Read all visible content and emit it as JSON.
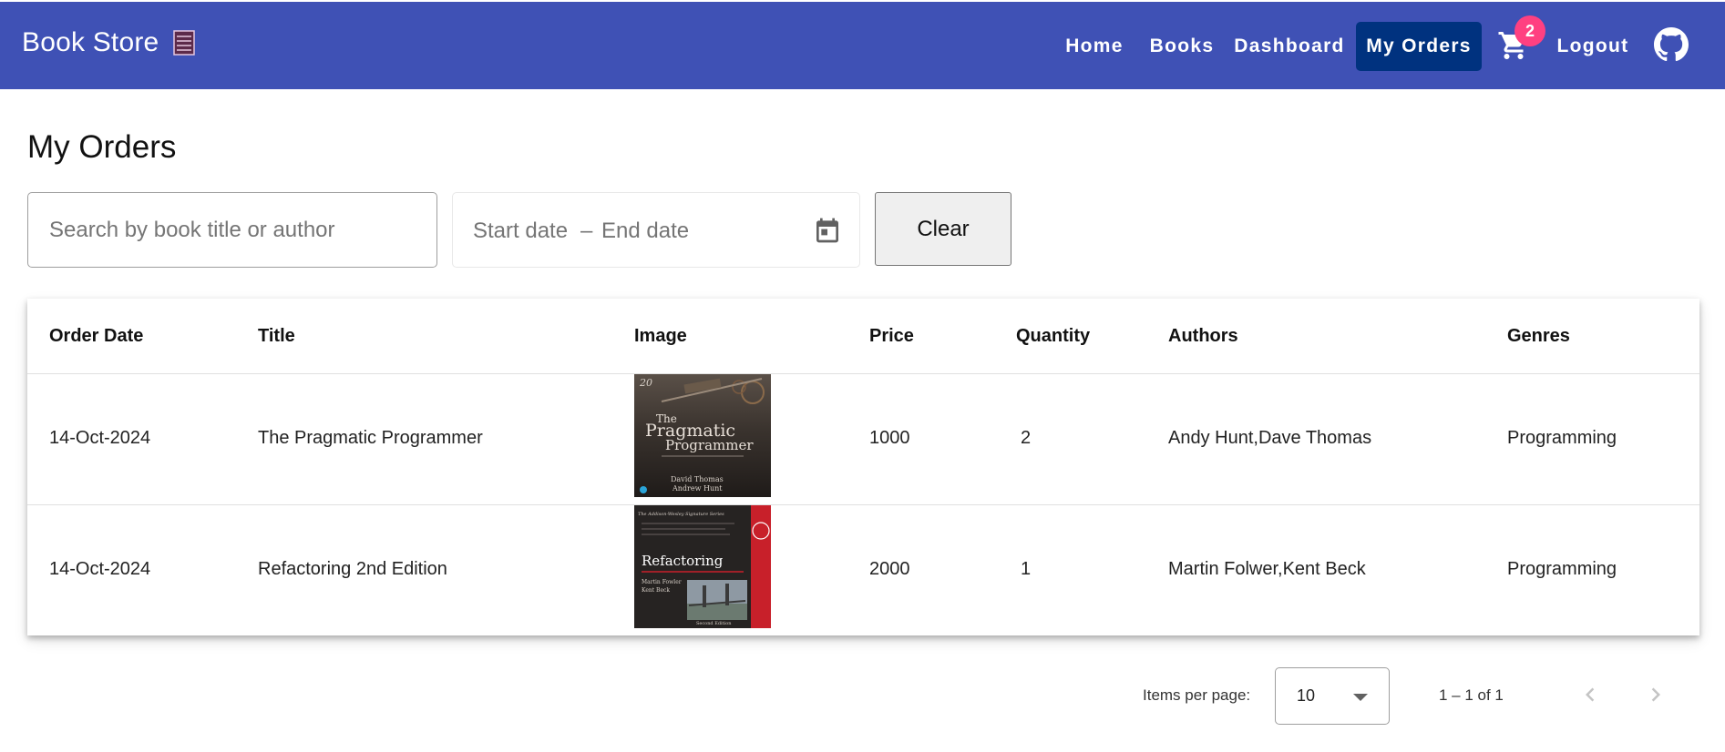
{
  "app": {
    "title": "Book Store",
    "brand_icon": "books-icon"
  },
  "nav": {
    "items": [
      {
        "label": "Home",
        "active": false
      },
      {
        "label": "Books",
        "active": false
      },
      {
        "label": "Dashboard",
        "active": false
      },
      {
        "label": "My Orders",
        "active": true
      }
    ],
    "cart_icon": "cart-icon",
    "cart_count": "2",
    "logout_label": "Logout",
    "github_icon": "github-icon"
  },
  "page": {
    "title": "My Orders"
  },
  "filters": {
    "search_placeholder": "Search by book title or author",
    "search_value": "",
    "start_placeholder": "Start date",
    "separator": "–",
    "end_placeholder": "End date",
    "calendar_icon": "calendar-icon",
    "clear_label": "Clear"
  },
  "table": {
    "headers": [
      "Order Date",
      "Title",
      "Image",
      "Price",
      "Quantity",
      "Authors",
      "Genres"
    ],
    "rows": [
      {
        "order_date": "14-Oct-2024",
        "title": "The Pragmatic Programmer",
        "image": "pragmatic-programmer-cover",
        "price": "1000",
        "quantity": "2",
        "authors": "Andy Hunt,Dave Thomas",
        "genres": "Programming"
      },
      {
        "order_date": "14-Oct-2024",
        "title": "Refactoring 2nd Edition",
        "image": "refactoring-cover",
        "price": "2000",
        "quantity": "1",
        "authors": "Martin Folwer,Kent Beck",
        "genres": "Programming"
      }
    ]
  },
  "covers": {
    "pragmatic": {
      "badge": "20",
      "line1": "The",
      "line2": "Pragmatic",
      "line3": "Programmer",
      "author1": "David Thomas",
      "author2": "Andrew Hunt"
    },
    "refactoring": {
      "series": "The Addison-Wesley Signature Series",
      "title": "Refactoring",
      "author1": "Martin Fowler",
      "author2": "Kent Beck",
      "edition": "Second Edition"
    }
  },
  "paginator": {
    "label": "Items per page:",
    "page_size": "10",
    "range": "1 – 1 of 1",
    "prev_icon": "chevron-left-icon",
    "next_icon": "chevron-right-icon"
  },
  "colors": {
    "toolbar": "#3f51b5",
    "active_nav": "#00327f",
    "badge": "#ff4081"
  }
}
